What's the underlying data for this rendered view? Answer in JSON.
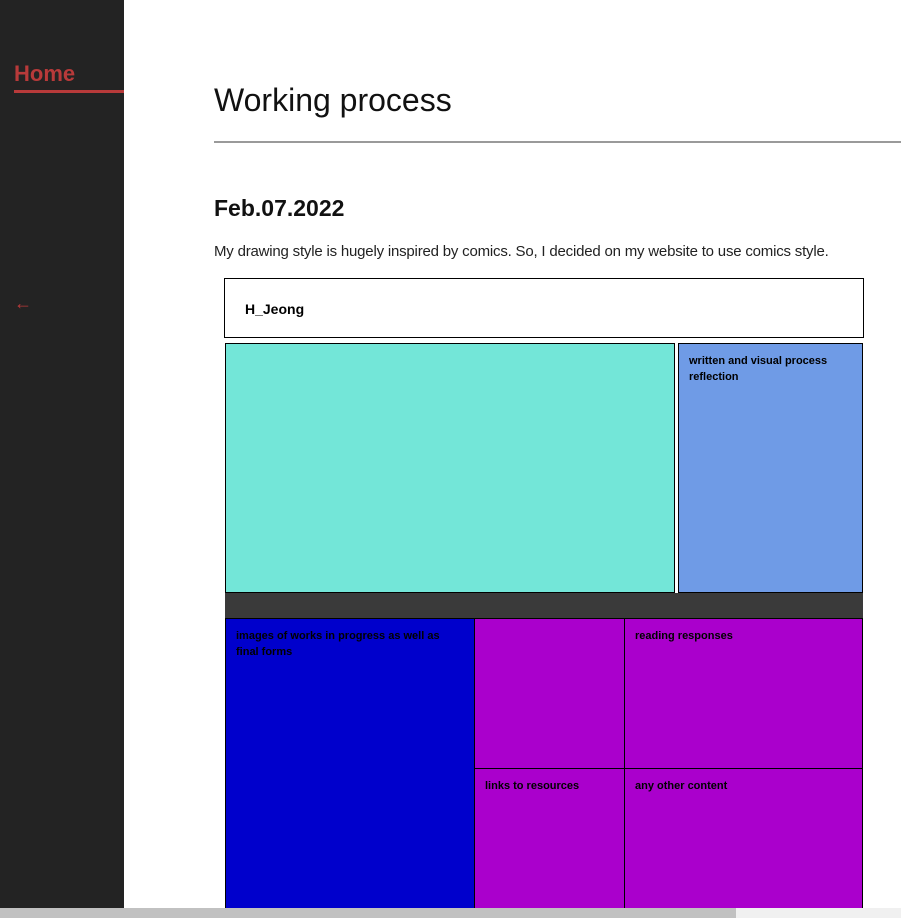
{
  "sidebar": {
    "home_label": "Home",
    "back_arrow": "←"
  },
  "main": {
    "title": "Working process",
    "date": "Feb.07.2022",
    "intro": "My drawing style is hugely inspired by comics. So, I decided on my website to use comics style."
  },
  "comic": {
    "header": "H_Jeong",
    "panels": {
      "reflection": "written and visual process reflection",
      "images": "images of works in progress as well as final forms",
      "empty": "",
      "reading": "reading responses",
      "links": "links to resources",
      "other": "any other content"
    }
  },
  "colors": {
    "sidebar_bg": "#232323",
    "accent": "#b83a3a",
    "teal": "#73e6d8",
    "cornflower": "#6f9be6",
    "navy": "#0000cc",
    "purple": "#aa00cc",
    "bar": "#3a3a3a"
  }
}
